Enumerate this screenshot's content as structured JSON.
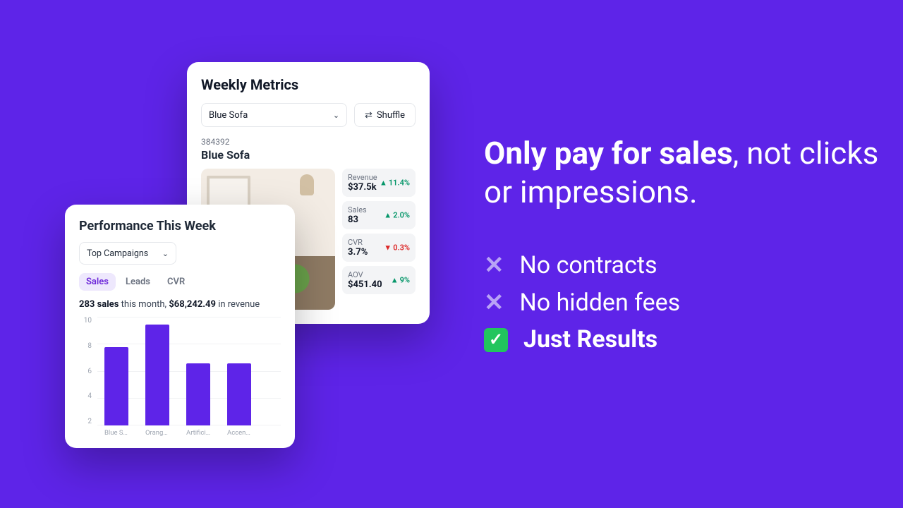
{
  "marketing": {
    "headline_bold": "Only pay for sales",
    "headline_rest": ", not clicks or impressions.",
    "bullets": {
      "no_contracts": "No contracts",
      "no_hidden_fees": "No hidden fees",
      "just_results": "Just Results"
    }
  },
  "metrics": {
    "title": "Weekly Metrics",
    "product_select": "Blue Sofa",
    "shuffle_label": "Shuffle",
    "sku": "384392",
    "product_name": "Blue Sofa",
    "stats": {
      "revenue": {
        "label": "Revenue",
        "value": "$37.5k",
        "delta": "11.4%",
        "dir": "up"
      },
      "sales": {
        "label": "Sales",
        "value": "83",
        "delta": "2.0%",
        "dir": "up"
      },
      "cvr": {
        "label": "CVR",
        "value": "3.7%",
        "delta": "0.3%",
        "dir": "down"
      },
      "aov": {
        "label": "AOV",
        "value": "$451.40",
        "delta": "9%",
        "dir": "up"
      }
    }
  },
  "performance": {
    "title": "Performance This Week",
    "select_label": "Top Campaigns",
    "tabs": {
      "sales": "Sales",
      "leads": "Leads",
      "cvr": "CVR"
    },
    "summary": {
      "sales_count": "283 sales",
      "mid": " this month, ",
      "revenue": "$68,242.49",
      "tail": " in revenue"
    }
  },
  "chart_data": {
    "type": "bar",
    "title": "Performance This Week — Sales",
    "categories": [
      "Blue Sofa",
      "Orange...",
      "Artificial...",
      "Accent..."
    ],
    "values": [
      7.2,
      9.3,
      5.7,
      5.7
    ],
    "ylim": [
      0,
      10
    ],
    "yticks": [
      10,
      8,
      6,
      4,
      2
    ],
    "xlabel": "",
    "ylabel": ""
  }
}
